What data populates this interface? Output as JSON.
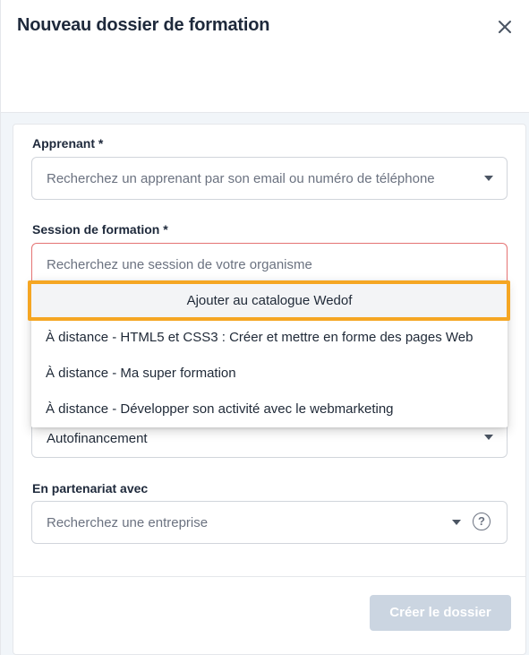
{
  "dialog": {
    "title": "Nouveau dossier de formation"
  },
  "form": {
    "learner": {
      "label": "Apprenant *",
      "placeholder": "Recherchez un apprenant par son email ou numéro de téléphone"
    },
    "session": {
      "label": "Session de formation *",
      "placeholder": "Recherchez une session de votre organisme"
    },
    "funding": {
      "value": "Autofinancement"
    },
    "partner": {
      "label": "En partenariat avec",
      "placeholder": "Recherchez une entreprise",
      "help": "?"
    }
  },
  "dropdown": {
    "add_label": "Ajouter au catalogue Wedof",
    "items": [
      "À distance - HTML5 et CSS3 : Créer et mettre en forme des pages Web",
      "À distance - Ma super formation",
      "À distance - Développer son activité avec le webmarketing"
    ]
  },
  "footer": {
    "submit_label": "Créer le dossier"
  },
  "colors": {
    "highlight": "#f5a623",
    "error_border": "#e57373",
    "disabled_button": "#cbd5e1"
  },
  "icons": {
    "close": "close-icon",
    "dropdown": "chevron-down-icon",
    "help": "help-circle-icon"
  }
}
